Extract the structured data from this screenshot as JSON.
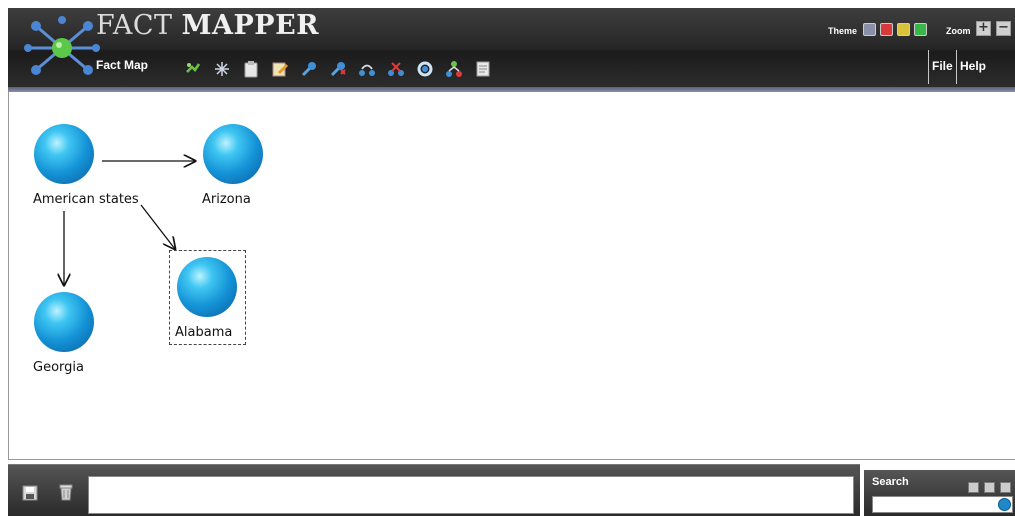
{
  "app": {
    "name_light": "FACT",
    "name_bold": "MAPPER",
    "section_title": "Fact Map"
  },
  "toolbar": {
    "icons": [
      "add-node-icon",
      "sparkle-icon",
      "clipboard-icon",
      "edit-note-icon",
      "link-pin-icon",
      "unlink-pin-icon",
      "connect-icon",
      "disconnect-icon",
      "refresh-icon",
      "hierarchy-icon",
      "document-icon"
    ]
  },
  "header_right": {
    "theme_label": "Theme",
    "theme_colors": [
      "#8a8fa8",
      "#d83a3a",
      "#d8c23a",
      "#38b648"
    ],
    "zoom_label": "Zoom",
    "zoom_in": "+",
    "zoom_out": "−"
  },
  "menu": {
    "file": "File",
    "help": "Help"
  },
  "map": {
    "nodes": [
      {
        "id": "american-states",
        "label": "American states"
      },
      {
        "id": "arizona",
        "label": "Arizona"
      },
      {
        "id": "georgia",
        "label": "Georgia"
      },
      {
        "id": "alabama",
        "label": "Alabama",
        "selected": true
      }
    ],
    "edges": [
      {
        "from": "american-states",
        "to": "arizona"
      },
      {
        "from": "american-states",
        "to": "georgia"
      },
      {
        "from": "american-states",
        "to": "alabama"
      }
    ]
  },
  "bottombar": {
    "input_value": ""
  },
  "search": {
    "label": "Search",
    "value": ""
  },
  "colors": {
    "header_dark": "#262626",
    "accent_line": "#8a8fa6",
    "sphere": "#1492d6"
  }
}
